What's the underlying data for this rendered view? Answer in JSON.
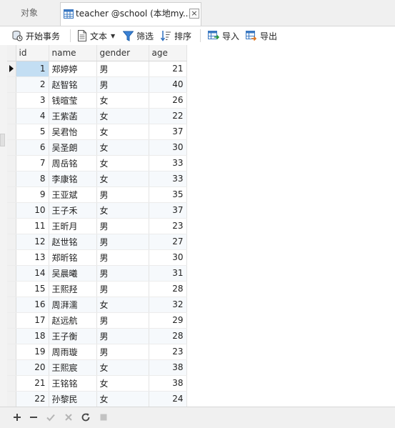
{
  "tabs": {
    "objects_label": "对象",
    "active_label": "teacher @school (本地my...",
    "close_label": "×"
  },
  "toolbar": {
    "begin_transaction": "开始事务",
    "text": "文本",
    "filter": "筛选",
    "sort": "排序",
    "import": "导入",
    "export": "导出"
  },
  "table": {
    "columns": [
      "id",
      "name",
      "gender",
      "age"
    ],
    "rows": [
      [
        "1",
        "郑婷婷",
        "男",
        "21"
      ],
      [
        "2",
        "赵智铭",
        "男",
        "40"
      ],
      [
        "3",
        "钱暄莹",
        "女",
        "26"
      ],
      [
        "4",
        "王紫菡",
        "女",
        "22"
      ],
      [
        "5",
        "吴君怡",
        "女",
        "37"
      ],
      [
        "6",
        "吴圣朗",
        "女",
        "30"
      ],
      [
        "7",
        "周岳铭",
        "女",
        "33"
      ],
      [
        "8",
        "李康铭",
        "女",
        "33"
      ],
      [
        "9",
        "王亚斌",
        "男",
        "35"
      ],
      [
        "10",
        "王子禾",
        "女",
        "37"
      ],
      [
        "11",
        "王昕月",
        "男",
        "23"
      ],
      [
        "12",
        "赵世铭",
        "男",
        "27"
      ],
      [
        "13",
        "郑昕铭",
        "男",
        "30"
      ],
      [
        "14",
        "吴晨曦",
        "男",
        "31"
      ],
      [
        "15",
        "王熙羟",
        "男",
        "28"
      ],
      [
        "16",
        "周湃濡",
        "女",
        "32"
      ],
      [
        "17",
        "赵远航",
        "男",
        "29"
      ],
      [
        "18",
        "王子衡",
        "男",
        "28"
      ],
      [
        "19",
        "周雨璇",
        "男",
        "23"
      ],
      [
        "20",
        "王熙宸",
        "女",
        "38"
      ],
      [
        "21",
        "王铭铭",
        "女",
        "38"
      ],
      [
        "22",
        "孙黎民",
        "女",
        "24"
      ]
    ],
    "current_row": 0
  },
  "bottom_bar": {
    "buttons": [
      "plus-icon",
      "minus-icon",
      "check-icon",
      "cancel-icon",
      "refresh-icon",
      "stop-icon"
    ]
  },
  "colors": {
    "accent": "#2e7bd1",
    "current_cell": "#c3def3"
  }
}
